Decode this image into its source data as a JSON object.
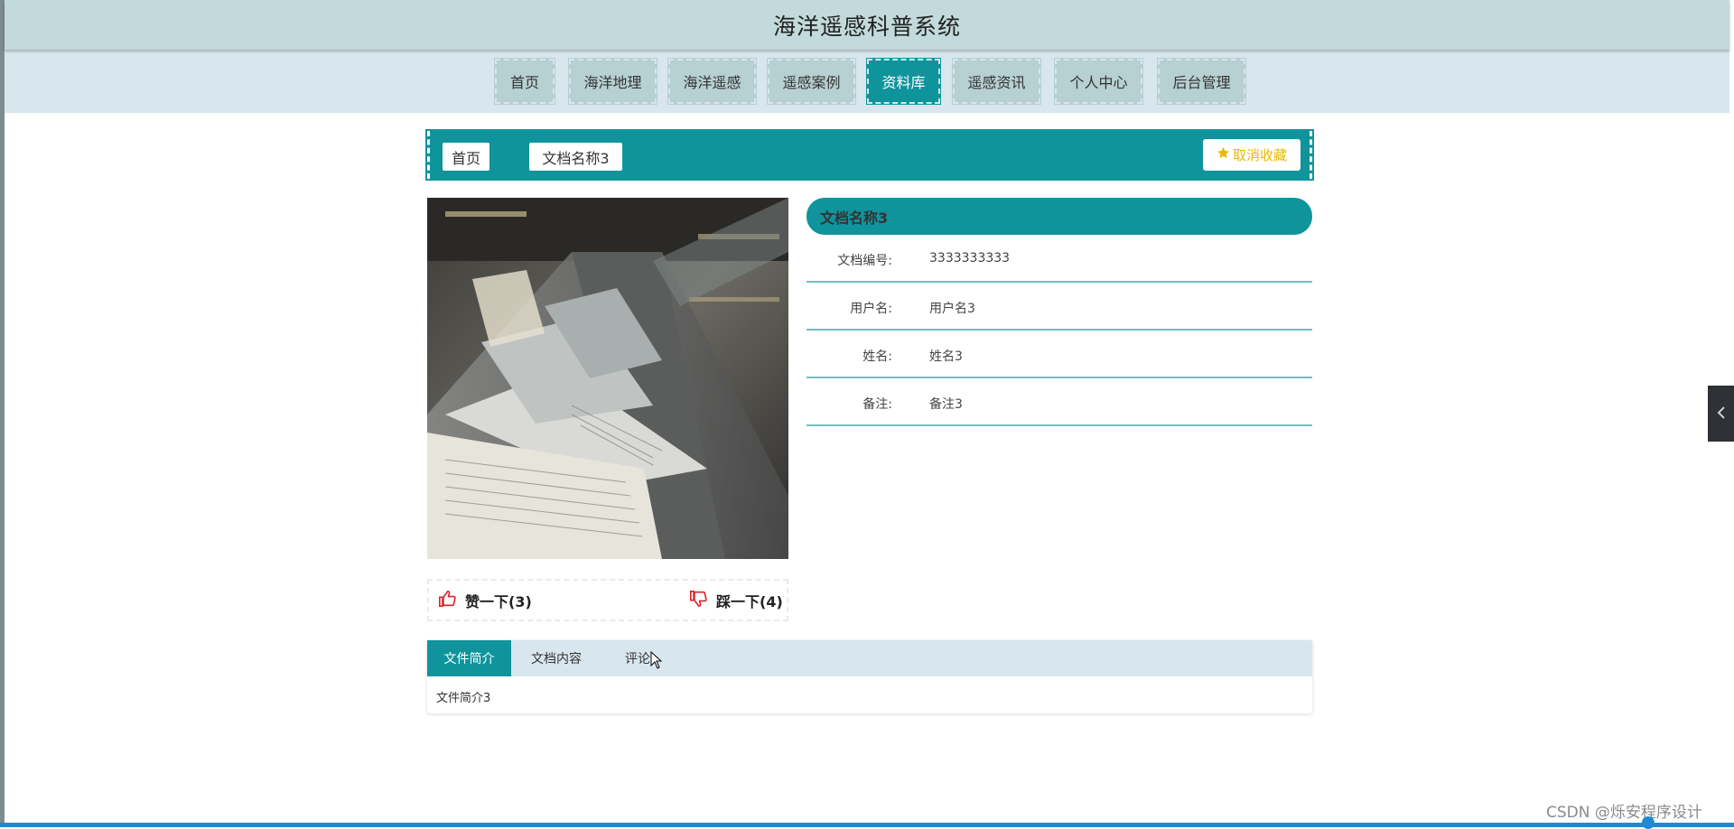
{
  "header": {
    "title": "海洋遥感科普系统"
  },
  "nav": {
    "items": [
      {
        "label": "首页"
      },
      {
        "label": "海洋地理"
      },
      {
        "label": "海洋遥感"
      },
      {
        "label": "遥感案例"
      },
      {
        "label": "资料库"
      },
      {
        "label": "遥感资讯"
      },
      {
        "label": "个人中心"
      },
      {
        "label": "后台管理"
      }
    ],
    "active": "资料库"
  },
  "breadcrumb": {
    "home": "首页",
    "current": "文档名称3"
  },
  "favorite": {
    "label": "取消收藏",
    "icon": "star-icon"
  },
  "detail": {
    "title": "文档名称3",
    "fields": [
      {
        "label": "文档编号:",
        "value": "3333333333"
      },
      {
        "label": "用户名:",
        "value": "用户名3"
      },
      {
        "label": "姓名:",
        "value": "姓名3"
      },
      {
        "label": "备注:",
        "value": "备注3"
      }
    ]
  },
  "votes": {
    "like_label": "赞一下(3)",
    "dislike_label": "踩一下(4)"
  },
  "tabs": {
    "items": [
      {
        "label": "文件简介"
      },
      {
        "label": "文档内容"
      },
      {
        "label": "评论"
      }
    ],
    "active": "文件简介",
    "content": "文件简介3"
  },
  "watermark": "CSDN @烁安程序设计",
  "colors": {
    "accent": "#10949c",
    "header_bg": "#c2dadb",
    "nav_bg": "#d8e6ee",
    "favorite": "#e8b800",
    "vote_red": "#d9232a"
  }
}
